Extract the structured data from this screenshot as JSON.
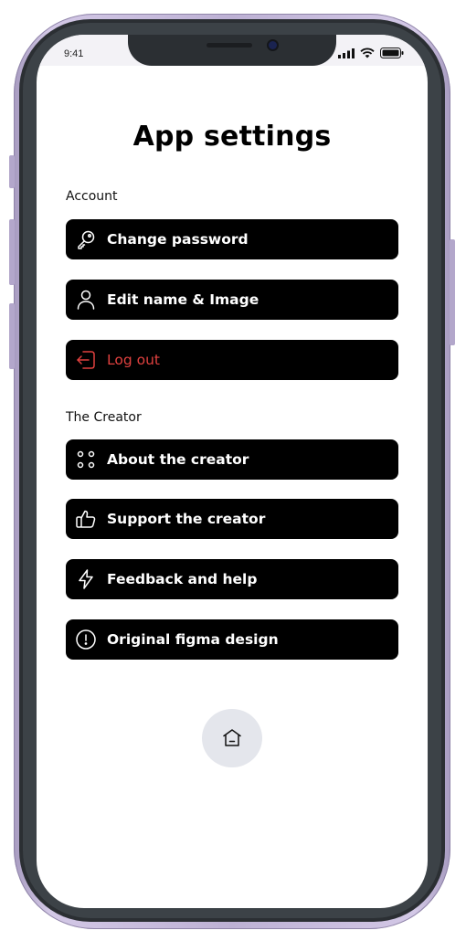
{
  "status_bar": {
    "time": "9:41"
  },
  "title": "App settings",
  "sections": [
    {
      "label": "Account",
      "items": [
        {
          "label": "Change password",
          "icon": "key-icon"
        },
        {
          "label": "Edit name & Image",
          "icon": "user-icon"
        },
        {
          "label": "Log out",
          "icon": "logout-icon",
          "color": "#e0413f"
        }
      ]
    },
    {
      "label": "The Creator",
      "items": [
        {
          "label": "About the creator",
          "icon": "dots-grid-icon"
        },
        {
          "label": "Support the creator",
          "icon": "thumbs-up-icon"
        },
        {
          "label": "Feedback and help",
          "icon": "lightning-icon"
        },
        {
          "label": "Original figma design",
          "icon": "info-circle-icon"
        }
      ]
    }
  ],
  "home_button": {
    "icon": "home-icon"
  },
  "colors": {
    "accent_danger": "#e0413f",
    "button_bg": "#000000",
    "home_bg": "#e4e6ec",
    "frame": "#bdb1d4"
  }
}
